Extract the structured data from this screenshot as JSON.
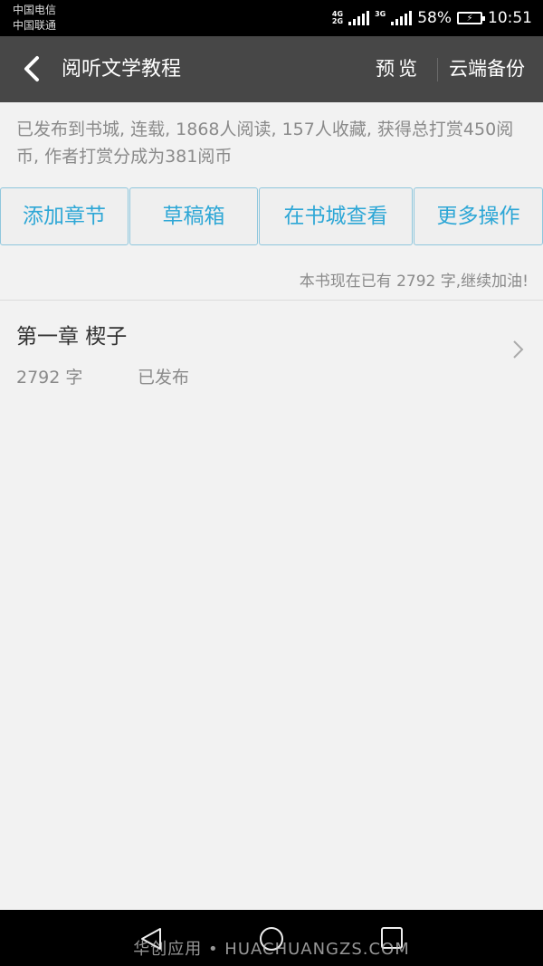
{
  "status_bar": {
    "carrier_1": "中国电信",
    "carrier_2": "中国联通",
    "network_1": "4G",
    "network_1b": "2G",
    "network_2": "3G",
    "battery": "58%",
    "time": "10:51"
  },
  "header": {
    "title": "阅听文学教程",
    "preview_label": "预览",
    "backup_label": "云端备份"
  },
  "info": {
    "text": "已发布到书城, 连载, 1868人阅读, 157人收藏, 获得总打赏450阅币, 作者打赏分成为381阅币"
  },
  "actions": [
    {
      "label": "添加章节"
    },
    {
      "label": "草稿箱"
    },
    {
      "label": "在书城查看"
    },
    {
      "label": "更多操作"
    }
  ],
  "word_count_text": "本书现在已有 2792 字,继续加油!",
  "chapters": [
    {
      "title": "第一章 楔子",
      "words": "2792 字",
      "status": "已发布"
    }
  ],
  "watermark": "华创应用 • HUACHUANGZS.COM",
  "colors": {
    "accent": "#2ea7d6",
    "header_bg": "#474747",
    "page_bg": "#f2f2f2"
  }
}
